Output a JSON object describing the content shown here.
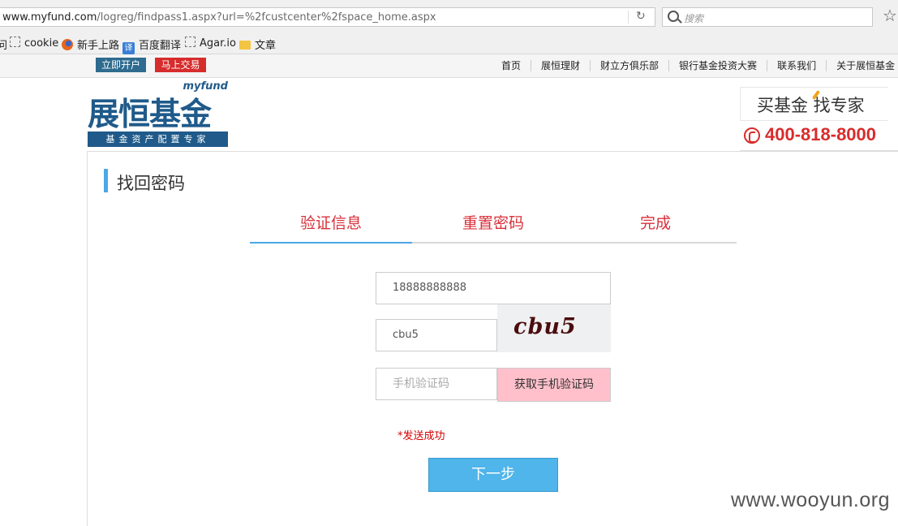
{
  "browser": {
    "url_domain": "www.myfund.com",
    "url_path": "/logreg/findpass1.aspx?url=%2fcustcenter%2fspace_home.aspx",
    "search_placeholder": "搜索",
    "bookmarks": [
      {
        "label": "问",
        "icon": "none"
      },
      {
        "label": "cookie",
        "icon": "dashed-square-icon"
      },
      {
        "label": "新手上路",
        "icon": "firefox-icon"
      },
      {
        "label": "百度翻译",
        "icon": "translate-icon"
      },
      {
        "label": "Agar.io",
        "icon": "dashed-square-icon"
      },
      {
        "label": "文章",
        "icon": "folder-icon"
      }
    ],
    "translate_icon_glyph": "译"
  },
  "topbar": {
    "open_account": "立即开户",
    "trade_now": "马上交易",
    "nav": [
      "首页",
      "展恒理财",
      "财立方俱乐部",
      "银行基金投资大赛",
      "联系我们",
      "关于展恒基金"
    ]
  },
  "header": {
    "logo_my": "myfund",
    "logo_main": "展恒基金",
    "logo_sub": "基金资产配置专家",
    "slogan": "买基金 找专家",
    "hotline": "400-818-8000"
  },
  "main": {
    "section_title": "找回密码",
    "steps": [
      "验证信息",
      "重置密码",
      "完成"
    ],
    "phone_value": "18888888888",
    "captcha_value": "cbu5",
    "captcha_image_text": "cbu5",
    "sms_placeholder": "手机验证码",
    "sms_button": "获取手机验证码",
    "status_message": "*发送成功",
    "next_button": "下一步"
  },
  "watermark": "www.wooyun.org",
  "colors": {
    "accent_blue": "#4aa8e6",
    "brand_blue": "#1f5a8a",
    "brand_red": "#d92b2b",
    "sms_button_bg": "#ffc0cb"
  }
}
